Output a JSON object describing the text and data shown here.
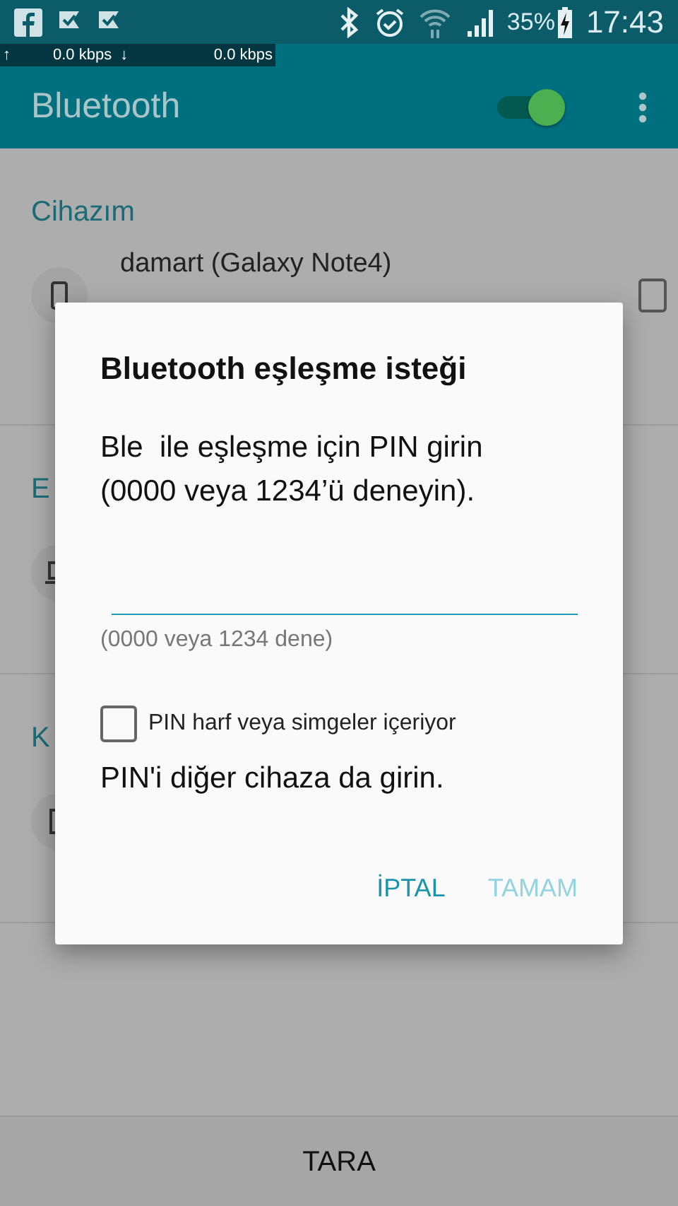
{
  "status_bar": {
    "battery": "35%",
    "time": "17:43"
  },
  "net_speed": {
    "up_arrow": "↑",
    "up": "0.0 kbps",
    "down_arrow": "↓",
    "down": "0.0 kbps"
  },
  "app_bar": {
    "title": "Bluetooth",
    "toggle_on": true
  },
  "sections": [
    {
      "header": "Cihazım",
      "device": {
        "name": "damart (Galaxy Note4)",
        "kind": "phone"
      }
    },
    {
      "header": "E",
      "device": {
        "kind": "laptop"
      }
    },
    {
      "header": "K",
      "device": {
        "kind": "phone-outline"
      }
    }
  ],
  "dialog": {
    "title": "Bluetooth eşleşme isteği",
    "message": "Ble  ile eşleşme için PIN girin (0000 veya 1234’ü deneyin).",
    "hint": "(0000 veya 1234 dene)",
    "checkbox": {
      "label": "PIN harf veya simgeler içeriyor",
      "checked": false
    },
    "note": "PIN'i diğer cihaza da girin.",
    "buttons": [
      {
        "label": "İPTAL",
        "disabled": false
      },
      {
        "label": "TAMAM",
        "disabled": true
      }
    ]
  },
  "bottom_button": "TARA"
}
